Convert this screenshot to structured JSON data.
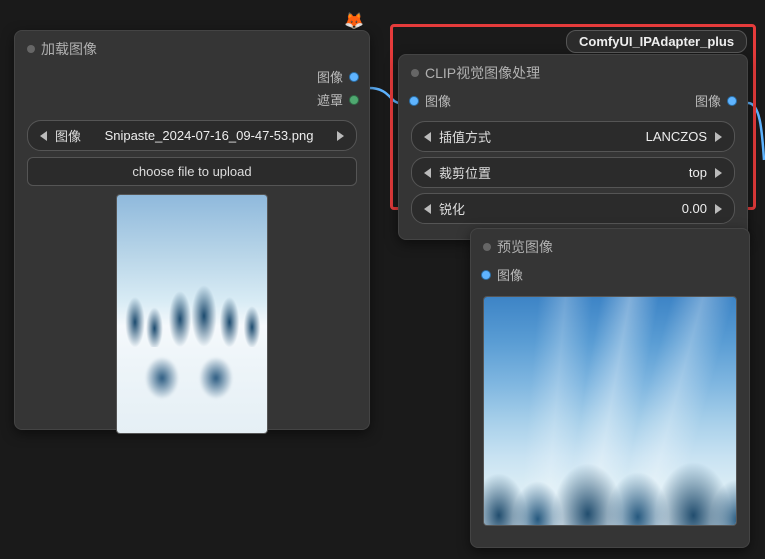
{
  "nodes": {
    "load": {
      "title": "加载图像",
      "outputs": {
        "image": "图像",
        "mask": "遮罩"
      },
      "file_widget": {
        "label": "图像",
        "value": "Snipaste_2024-07-16_09-47-53.png"
      },
      "upload_button": "choose file to upload"
    },
    "clip": {
      "badge": "ComfyUI_IPAdapter_plus",
      "title": "CLIP视觉图像处理",
      "inputs": {
        "image": "图像"
      },
      "outputs": {
        "image": "图像"
      },
      "widgets": {
        "interpolation": {
          "label": "插值方式",
          "value": "LANCZOS"
        },
        "crop_position": {
          "label": "裁剪位置",
          "value": "top"
        },
        "sharpening": {
          "label": "锐化",
          "value": "0.00"
        }
      }
    },
    "preview": {
      "title": "预览图像",
      "inputs": {
        "image": "图像"
      }
    }
  },
  "icons": {
    "fox": "🦊"
  }
}
